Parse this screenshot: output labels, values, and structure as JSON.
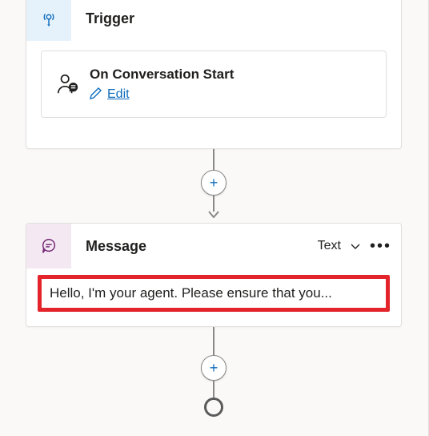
{
  "trigger": {
    "title": "Trigger",
    "event_title": "On Conversation Start",
    "edit_label": "Edit"
  },
  "message": {
    "title": "Message",
    "type_label": "Text",
    "body": "Hello, I'm your agent. Please ensure that you..."
  },
  "icons": {
    "trigger": "broadcast-icon",
    "event": "person-speech-icon",
    "edit": "pencil-icon",
    "message": "speech-bubble-icon",
    "chevron": "chevron-down-icon",
    "more": "more-icon",
    "add": "add-icon"
  },
  "colors": {
    "accent": "#0f6cbd",
    "trigger_bg": "#e6f2fb",
    "message_bg": "#f4e9f3",
    "highlight": "#e3242b",
    "canvas_bg": "#faf9f8"
  }
}
